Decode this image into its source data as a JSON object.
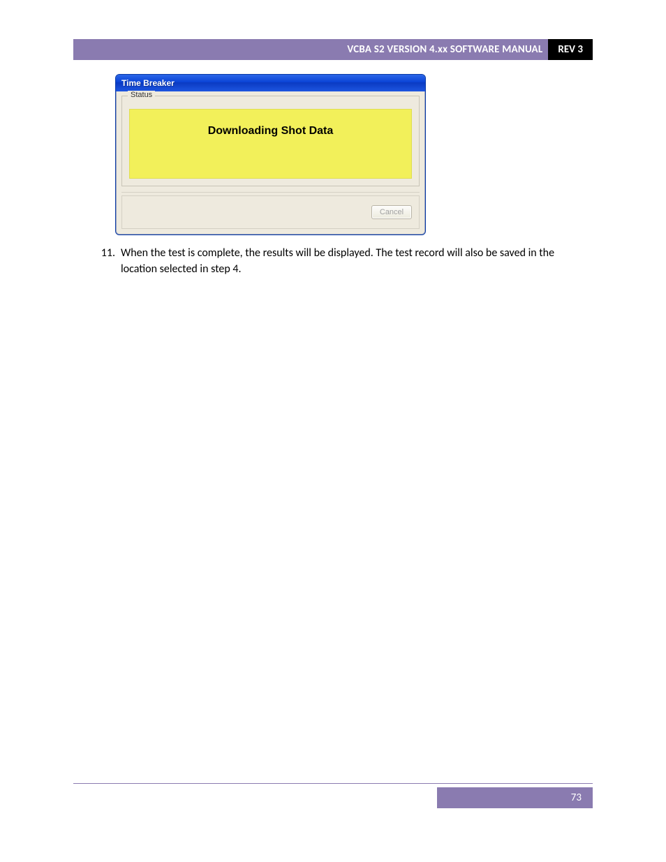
{
  "header": {
    "title": "VCBA S2 VERSION 4.xx SOFTWARE MANUAL",
    "rev": "REV 3"
  },
  "dialog": {
    "title": "Time Breaker",
    "status_legend": "Status",
    "status_message": "Downloading Shot Data",
    "cancel_label": "Cancel"
  },
  "step": {
    "number": "11.",
    "text": "When the test is complete, the results will be displayed. The test record will also be saved in the location selected in step 4."
  },
  "footer": {
    "page_number": "73"
  }
}
